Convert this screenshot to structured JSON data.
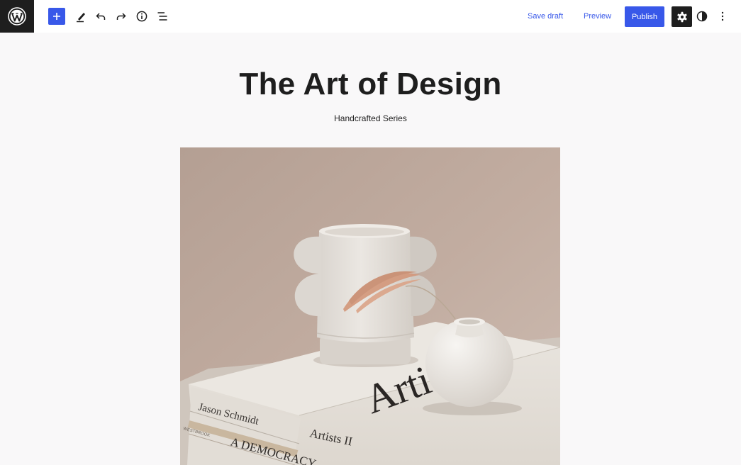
{
  "toolbar": {
    "save_draft_label": "Save draft",
    "preview_label": "Preview",
    "publish_label": "Publish"
  },
  "post": {
    "title": "The Art of Design",
    "subtitle": "Handcrafted Series"
  },
  "image": {
    "book1_author": "Jason Schmidt",
    "book1_title": "Artists II",
    "book1_cover_text": "Artists",
    "book2_title": "A DEMOCRACY",
    "book3_label": "WESTBROOK"
  },
  "colors": {
    "accent": "#3858e9",
    "dark": "#1e1e1e",
    "canvas": "#f9f8f9"
  }
}
